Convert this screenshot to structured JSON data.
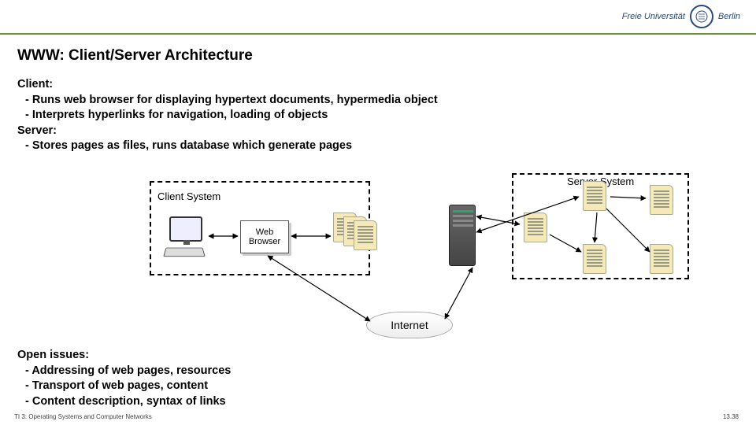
{
  "logo": {
    "text": "Freie Universität",
    "city": "Berlin"
  },
  "title": "WWW: Client/Server Architecture",
  "content1": {
    "client_heading": "Client:",
    "client_b1": "- Runs web browser for displaying hypertext documents, hypermedia object",
    "client_b2": "- Interprets hyperlinks for navigation, loading of objects",
    "server_heading": "Server:",
    "server_b1": "- Stores pages as files, runs database which generate pages"
  },
  "diagram": {
    "client_label": "Client System",
    "server_label": "Server System",
    "web_browser": "Web Browser",
    "internet": "Internet"
  },
  "content2": {
    "heading": "Open issues:",
    "b1": "- Addressing of web pages, resources",
    "b2": "- Transport of web pages, content",
    "b3": "- Content description, syntax of links"
  },
  "footer": {
    "left": "TI 3: Operating Systems and Computer Networks",
    "right": "13.38"
  }
}
